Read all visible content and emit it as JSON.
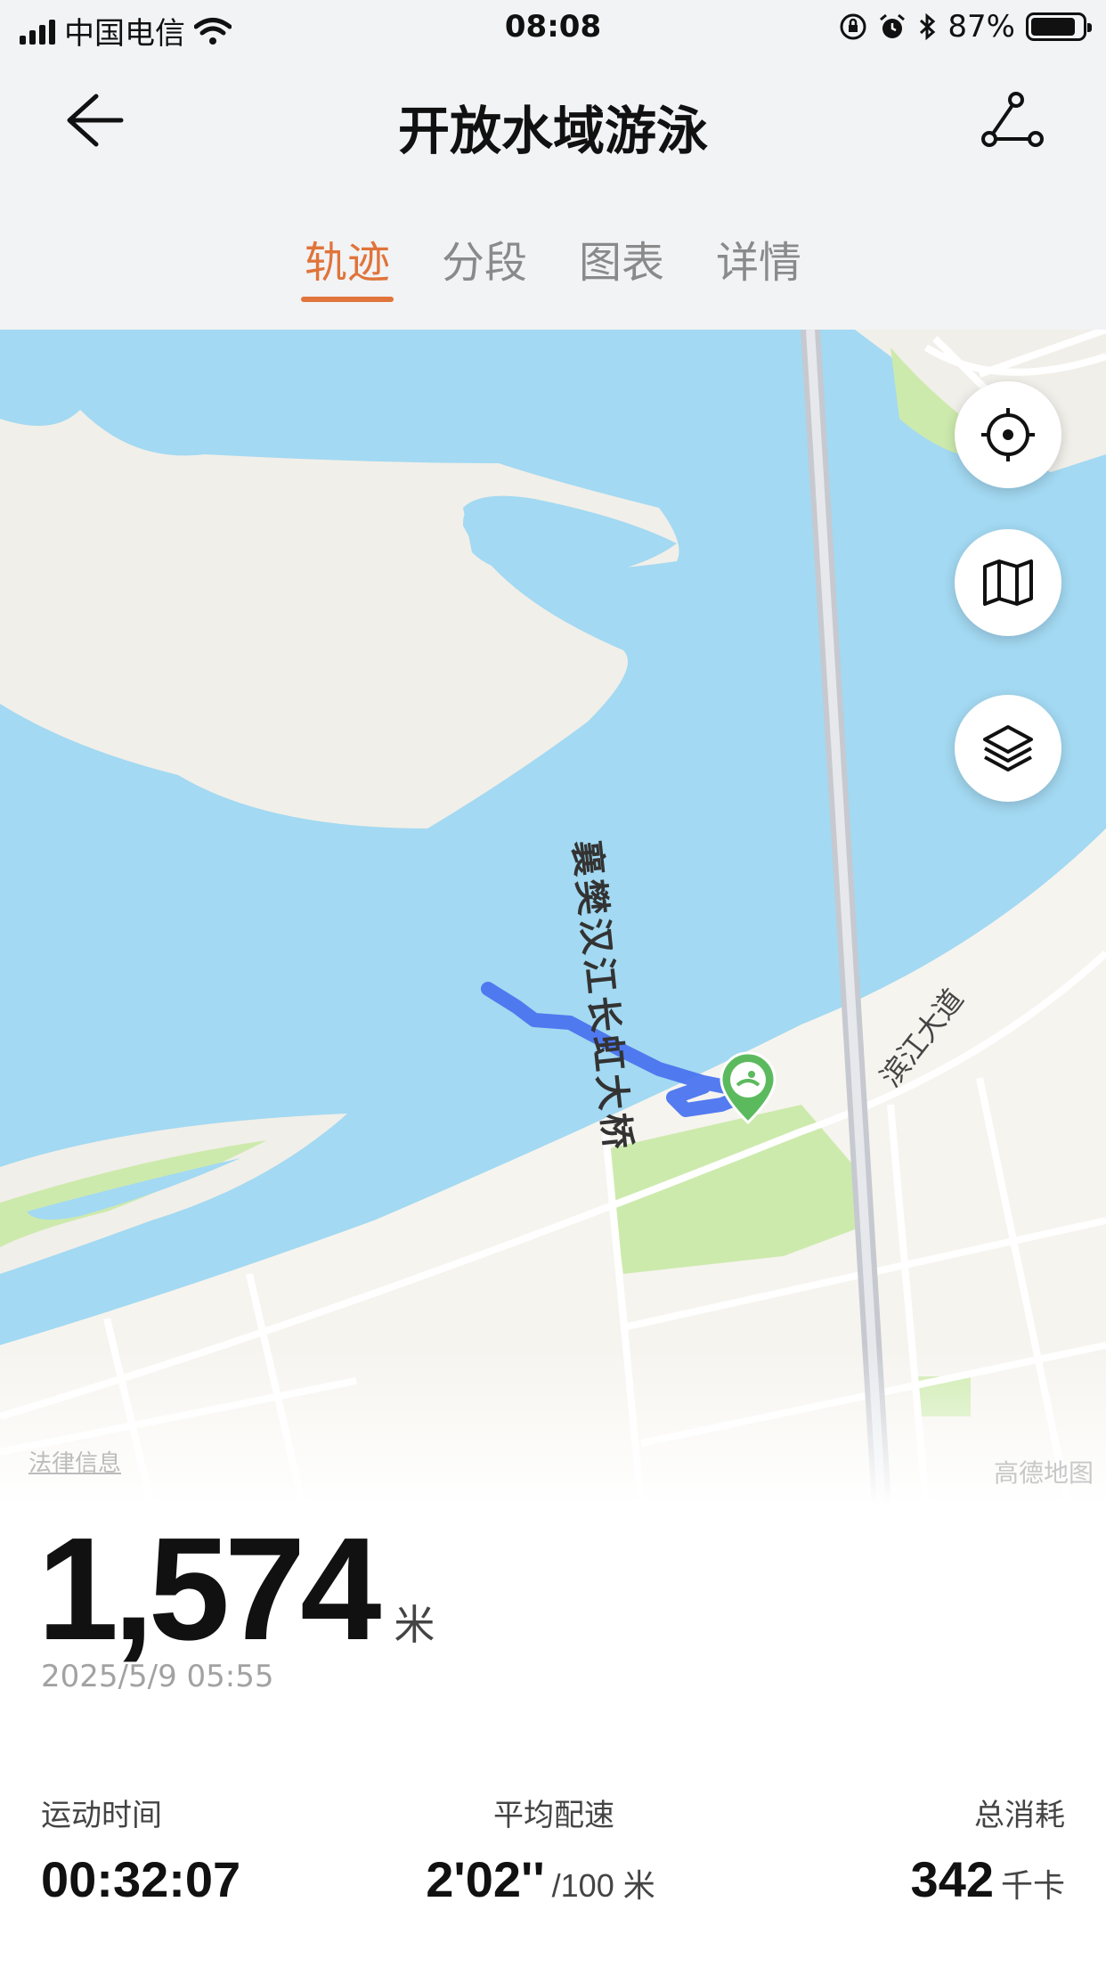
{
  "status_bar": {
    "carrier": "中国电信",
    "time": "08:08",
    "battery": "87%",
    "battery_level": 0.87
  },
  "header": {
    "title": "开放水域游泳"
  },
  "tabs": [
    {
      "label": "轨迹",
      "active": true
    },
    {
      "label": "分段",
      "active": false
    },
    {
      "label": "图表",
      "active": false
    },
    {
      "label": "详情",
      "active": false
    }
  ],
  "map": {
    "bridge_label": "襄樊汉江长虹大桥",
    "road_label": "滨江大道",
    "legal_link": "法律信息",
    "brand": "高德地图",
    "colors": {
      "water": "#a3d9f2",
      "land": "#f1efe9",
      "track": "#4b74ee",
      "park": "#cdeaad",
      "marker": "#5cba5e"
    }
  },
  "summary": {
    "distance": "1,574",
    "distance_unit": "米",
    "date": "2025/5/9 05:55",
    "stats": [
      {
        "label": "运动时间",
        "value": "00:32:07",
        "unit": ""
      },
      {
        "label": "平均配速",
        "value": "2'02''",
        "unit": "/100 米"
      },
      {
        "label": "总消耗",
        "value": "342",
        "unit": "千卡"
      }
    ]
  }
}
